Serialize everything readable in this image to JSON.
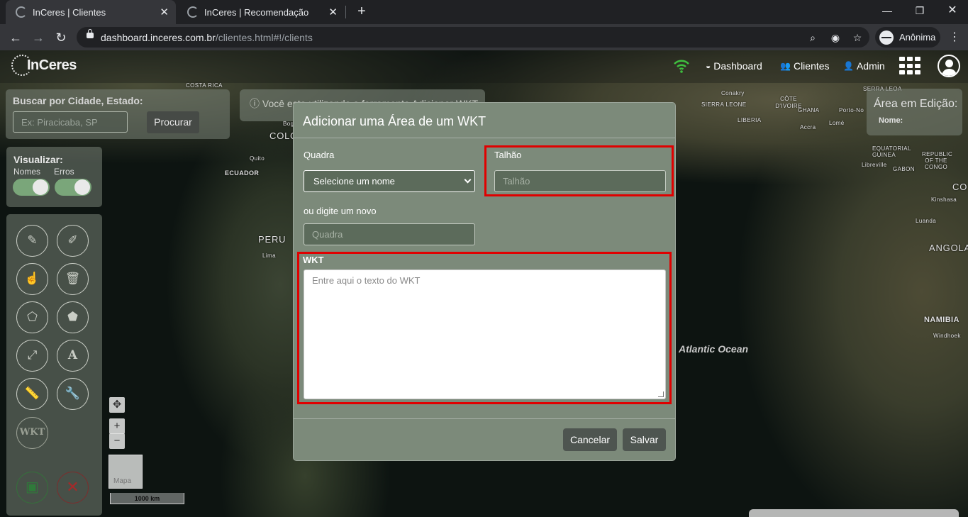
{
  "browser": {
    "tabs": [
      {
        "title": "InCeres | Clientes",
        "active": true
      },
      {
        "title": "InCeres | Recomendação",
        "active": false
      }
    ],
    "new_tab_symbol": "+",
    "url_host": "dashboard.inceres.com.br",
    "url_path": "/clientes.html#!/clients",
    "profile_label": "Anônima",
    "window_controls": [
      "minimize",
      "restore",
      "close"
    ]
  },
  "app": {
    "logo_text": "InCeres",
    "nav": [
      {
        "label": "Dashboard",
        "icon": "dashboard-icon"
      },
      {
        "label": "Clientes",
        "icon": "users-icon"
      },
      {
        "label": "Admin",
        "icon": "user-plus-icon"
      }
    ],
    "accent_color": "#3fbf3f"
  },
  "search": {
    "title": "Buscar por Cidade, Estado:",
    "placeholder": "Ex: Piracicaba, SP",
    "button": "Procurar"
  },
  "visualize": {
    "title": "Visualizar:",
    "toggles": [
      {
        "label": "Nomes",
        "on": true
      },
      {
        "label": "Erros",
        "on": true
      }
    ]
  },
  "tools": {
    "wkt_label": "WKT"
  },
  "map": {
    "zoom_in": "+",
    "zoom_out": "−",
    "minimap_label": "Mapa",
    "scale_label": "1000 km",
    "ocean_label": "Atlantic Ocean",
    "labels": [
      "COSTA RICA",
      "Quito",
      "ECUADOR",
      "PERU",
      "Lima",
      "COLO",
      "Bog",
      "Conakry",
      "SIERRA LEONE",
      "CÔTE D'IVOIRE",
      "LIBERIA",
      "GHANA",
      "Porto-No",
      "Accra",
      "Lomé",
      "SERRA LEOA",
      "EQUATORIAL GUINEA",
      "Libreville",
      "GABON",
      "REPUBLIC OF THE CONGO",
      "Kinshasa",
      "Luanda",
      "ANGOLA",
      "NAMIBIA",
      "Windhoek",
      "CO"
    ]
  },
  "tool_notice": "Você esta utilizando a ferramenta Adicionar WKT",
  "area_edit": {
    "title": "Área em Edição:",
    "name_label": "Nome:"
  },
  "modal": {
    "title": "Adicionar uma Área de um WKT",
    "quadra_label": "Quadra",
    "quadra_select": "Selecione um nome",
    "talhao_label": "Talhão",
    "talhao_placeholder": "Talhão",
    "or_new_label": "ou digite um novo",
    "quadra_placeholder": "Quadra",
    "wkt_label": "WKT",
    "wkt_placeholder": "Entre aqui o texto do WKT",
    "cancel": "Cancelar",
    "save": "Salvar",
    "highlight_color": "#e00000"
  }
}
